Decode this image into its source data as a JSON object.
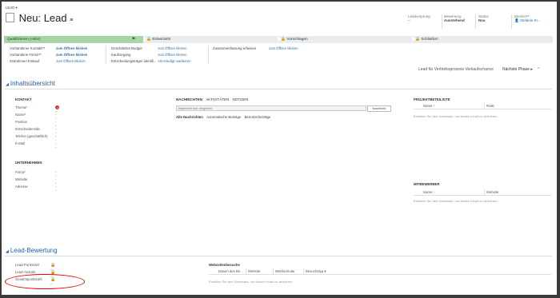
{
  "header": {
    "entity_label": "LEAD",
    "title": "Neu: Lead",
    "fields": [
      {
        "label": "Leadursprung",
        "value": "--"
      },
      {
        "label": "Bewertung",
        "value": "Ausstehend"
      },
      {
        "label": "Status",
        "value": "Neu"
      },
      {
        "label": "Besitzer",
        "value": "Stefanie Kr..."
      }
    ]
  },
  "process": {
    "stages": [
      "Qualifizieren (Aktiv)",
      "Entwickeln",
      "Vorschlagen",
      "Schließen"
    ],
    "step_columns": [
      [
        {
          "label": "Vorhandener Kontakt?",
          "value": "zum Öffnen klicken",
          "required": true
        },
        {
          "label": "Vorhandene Firma?",
          "value": "zum Öffnen klicken",
          "required": true
        },
        {
          "label": "Zeitrahmen Einkauf",
          "value": "zum Öffnen klicken",
          "required": false
        }
      ],
      [
        {
          "label": "Geschätztes Budget",
          "value": "zum Öffnen klicken"
        },
        {
          "label": "Kaufvorgang",
          "value": "zum Öffnen klicken"
        },
        {
          "label": "Entscheidungsträger identifi...",
          "value": "Als erledigt markieren"
        }
      ],
      [
        {
          "label": "Zusammenfassung erfassen",
          "value": "zum Öffnen klicken"
        }
      ]
    ],
    "footer_label": "Lead für Vertriebsprozess Verkaufschance",
    "next_phase": "Nächste Phase"
  },
  "overview": {
    "title": "Inhaltsübersicht",
    "kontakt_heading": "KONTAKT",
    "kontakt_fields": [
      {
        "label": "Thema",
        "required": true,
        "value": "--"
      },
      {
        "label": "Name",
        "required": true,
        "value": "--"
      },
      {
        "label": "Position",
        "required": false,
        "value": "--"
      },
      {
        "label": "Entscheiderrolle",
        "required": false,
        "value": "--"
      },
      {
        "label": "Telefon (geschäftlich)",
        "required": false,
        "value": "--"
      },
      {
        "label": "E-Mail",
        "required": false,
        "value": "--"
      }
    ],
    "unternehmen_heading": "UNTERNEHMEN",
    "unternehmen_fields": [
      {
        "label": "Firma",
        "required": true,
        "value": "--"
      },
      {
        "label": "Website",
        "required": false,
        "value": "--"
      },
      {
        "label": "Adresse",
        "required": false,
        "value": "--"
      }
    ],
    "activity_tabs": [
      "NACHRICHTEN",
      "AKTIVITÄTEN",
      "NOTIZEN"
    ],
    "note_placeholder": "Nachricht hier eingeben",
    "post_button": "Nachricht",
    "filters": [
      "Alle Nachrichten",
      "Automatische Beiträge",
      "Benutzerbeiträge"
    ],
    "projekt_title": "PROJEKTBETEILIGTE",
    "projekt_cols": [
      "Name",
      "Rolle"
    ],
    "projekt_empty": "Erstellen Sie den Datensatz, um diesen Inhalt zu aktivieren.",
    "mitbewerber_title": "MITBEWERBER",
    "mitbewerber_cols": [
      "Name",
      "Website"
    ],
    "mitbewerber_empty": "Erstellen Sie den Datensatz, um diesen Inhalt zu aktivieren."
  },
  "rating": {
    "title": "Lead-Bewertung",
    "fields": [
      {
        "label": "Lead-Punktzahl",
        "value": "--"
      },
      {
        "label": "Lead-Anstufe",
        "value": "--"
      },
      {
        "label": "Gesamtpunktzahl",
        "value": "--"
      }
    ],
    "web_title": "Webseitenbesuche",
    "web_cols": [
      "Datum des Be...",
      "Website",
      "Webformular",
      "Besuchstyp"
    ],
    "web_empty": "Erstellen Sie den Datensatz, um diesen Inhalt zu aktivieren."
  },
  "colors": {
    "active_stage": "#a8d5a8",
    "link": "#2b6cb0",
    "section_title": "#1f5fa8",
    "annotation": "#e00000"
  }
}
